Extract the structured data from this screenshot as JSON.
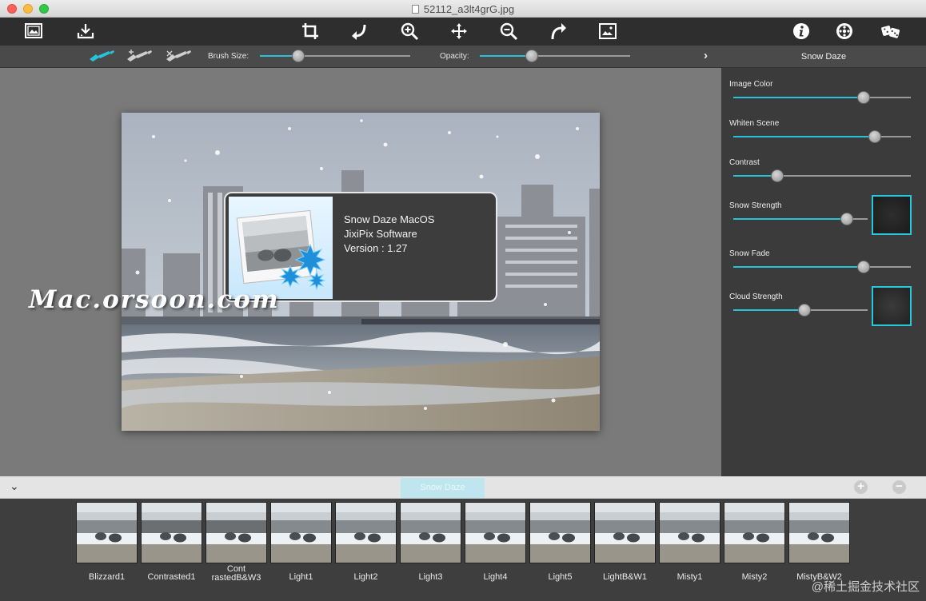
{
  "window": {
    "title": "52112_a3lt4grG.jpg"
  },
  "toolbar": {
    "left": [
      {
        "name": "open-image-icon"
      },
      {
        "name": "save-icon"
      }
    ],
    "center": [
      {
        "name": "crop-icon"
      },
      {
        "name": "rotate-left-icon"
      },
      {
        "name": "zoom-in-icon"
      },
      {
        "name": "move-icon"
      },
      {
        "name": "zoom-out-icon"
      },
      {
        "name": "rotate-right-icon"
      },
      {
        "name": "fit-image-icon"
      }
    ],
    "right": [
      {
        "name": "info-icon"
      },
      {
        "name": "settings-wheel-icon"
      },
      {
        "name": "random-dice-icon"
      }
    ]
  },
  "subbar": {
    "brush_size_label": "Brush Size:",
    "brush_size_value": 0.23,
    "opacity_label": "Opacity:",
    "opacity_value": 0.33,
    "brushes": [
      "brush-paint-icon",
      "brush-add-icon",
      "brush-erase-icon"
    ]
  },
  "panel": {
    "title": "Snow Daze",
    "sliders": [
      {
        "label": "Image Color",
        "value": 0.75,
        "preview": false
      },
      {
        "label": "Whiten Scene",
        "value": 0.82,
        "preview": false
      },
      {
        "label": "Contrast",
        "value": 0.23,
        "preview": false
      },
      {
        "label": "Snow Strength",
        "value": 0.88,
        "preview": true
      },
      {
        "label": "Snow Fade",
        "value": 0.75,
        "preview": false
      },
      {
        "label": "Cloud Strength",
        "value": 0.53,
        "preview": true
      }
    ]
  },
  "about": {
    "line1": "Snow Daze MacOS",
    "line2": "JixiPix Software",
    "line3": "Version : 1.27"
  },
  "watermark": "Mac.orsoon.com",
  "bottombar": {
    "active_tab": "Snow Daze",
    "add_label": "+",
    "remove_label": "−"
  },
  "presets": [
    "Blizzard1",
    "Contrasted1",
    "Cont\nrastedB&W3",
    "Light1",
    "Light2",
    "Light3",
    "Light4",
    "Light5",
    "LightB&W1",
    "Misty1",
    "Misty2",
    "MistyB&W2"
  ],
  "corner_watermark": "@稀土掘金技术社区",
  "colors": {
    "accent": "#26c4d9",
    "panel": "#3b3b3b",
    "canvas": "#7a7a7a"
  }
}
